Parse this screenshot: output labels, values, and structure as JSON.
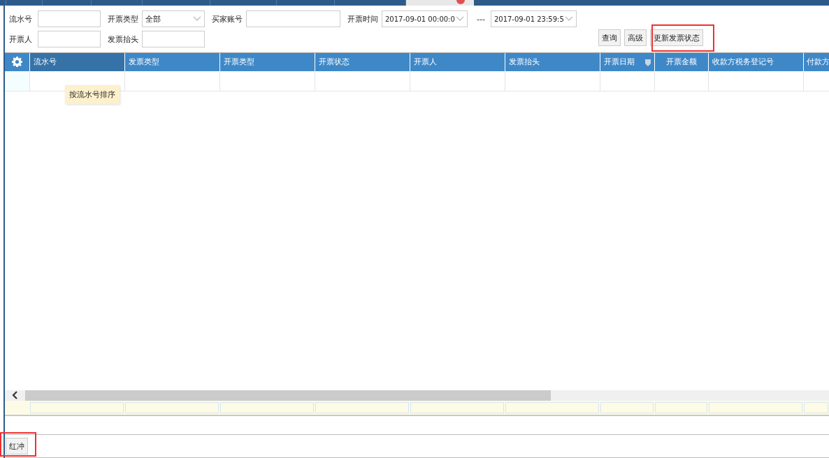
{
  "tabs": [
    {
      "selected": false
    },
    {
      "selected": false
    },
    {
      "selected": false
    },
    {
      "selected": false
    },
    {
      "selected": false
    },
    {
      "selected": false
    },
    {
      "selected": false
    },
    {
      "selected": true,
      "closable": true
    }
  ],
  "filters": {
    "row1": [
      {
        "kind": "input",
        "label": "流水号"
      },
      {
        "kind": "select",
        "label": "开票类型",
        "value": "全部"
      },
      {
        "kind": "input",
        "label": "买家账号"
      },
      {
        "kind": "range",
        "label": "开票时间",
        "from": "2017-09-01 00:00:0",
        "separator": "---",
        "to": "2017-09-01 23:59:5"
      }
    ],
    "row2": [
      {
        "kind": "input",
        "label": "开票人"
      },
      {
        "kind": "input",
        "label": "发票抬头"
      }
    ]
  },
  "buttons": [
    {
      "label": "查询",
      "highlighted": false
    },
    {
      "label": "高级",
      "highlighted": false
    },
    {
      "label": "更新发票状态",
      "highlighted": true
    }
  ],
  "table": {
    "columns": [
      {
        "label": "流水号",
        "sorted": true
      },
      {
        "label": "发票类型",
        "sorted": false
      },
      {
        "label": "开票类型",
        "sorted": false
      },
      {
        "label": "开票状态",
        "sorted": false
      },
      {
        "label": "开票人",
        "sorted": false
      },
      {
        "label": "发票抬头",
        "sorted": false
      },
      {
        "label": "开票日期",
        "sorted": false,
        "filter_icon": true
      },
      {
        "label": "开票金额",
        "sorted": false
      },
      {
        "label": "收款方税务登记号",
        "sorted": false
      },
      {
        "label": "付款方",
        "sorted": false
      }
    ],
    "tooltip": "按流水号排序"
  },
  "bottom_buttons": [
    {
      "label": "红冲",
      "highlighted": true
    }
  ]
}
